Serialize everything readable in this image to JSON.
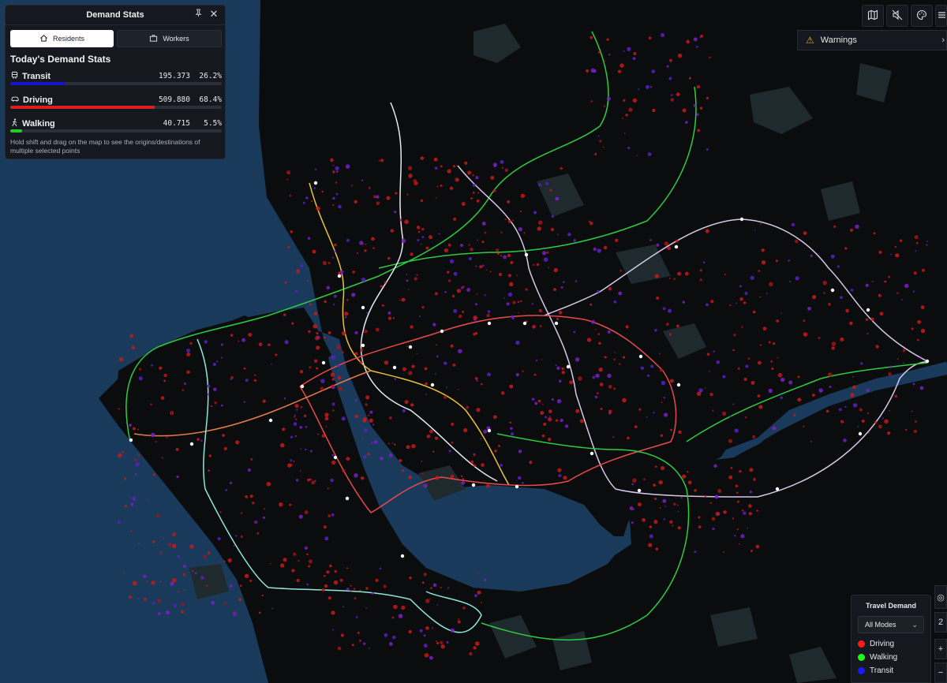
{
  "panel": {
    "title": "Demand Stats",
    "tabs": [
      {
        "label": "Residents",
        "icon": "home-icon",
        "active": true
      },
      {
        "label": "Workers",
        "icon": "briefcase-icon",
        "active": false
      }
    ],
    "section_title": "Today's Demand Stats",
    "rows": [
      {
        "label": "Transit",
        "icon": "train-icon",
        "value": "195.373",
        "percent": "26.2%",
        "fraction": 0.262,
        "color": "#1414c8"
      },
      {
        "label": "Driving",
        "icon": "car-icon",
        "value": "509.880",
        "percent": "68.4%",
        "fraction": 0.684,
        "color": "#e01b1b"
      },
      {
        "label": "Walking",
        "icon": "walking-icon",
        "value": "40.715",
        "percent": "5.5%",
        "fraction": 0.055,
        "color": "#22cc22"
      }
    ],
    "hint": "Hold shift and drag on the map to see the origins/destinations of multiple selected points"
  },
  "toolbar": {
    "buttons": [
      {
        "name": "map-icon"
      },
      {
        "name": "mute-icon"
      },
      {
        "name": "palette-icon"
      },
      {
        "name": "menu-icon"
      }
    ]
  },
  "warnings": {
    "label": "Warnings"
  },
  "legend": {
    "title": "Travel Demand",
    "selected_mode": "All Modes",
    "items": [
      {
        "label": "Driving",
        "color": "#ff1a1a"
      },
      {
        "label": "Walking",
        "color": "#1aff1a"
      },
      {
        "label": "Transit",
        "color": "#1a1aff"
      }
    ]
  },
  "side_controls": {
    "zoom_label": "2",
    "plus_label": "+"
  },
  "colors": {
    "water": "#1a3a5c",
    "land": "#0b0c0e",
    "parks": "#1f2a2e"
  }
}
